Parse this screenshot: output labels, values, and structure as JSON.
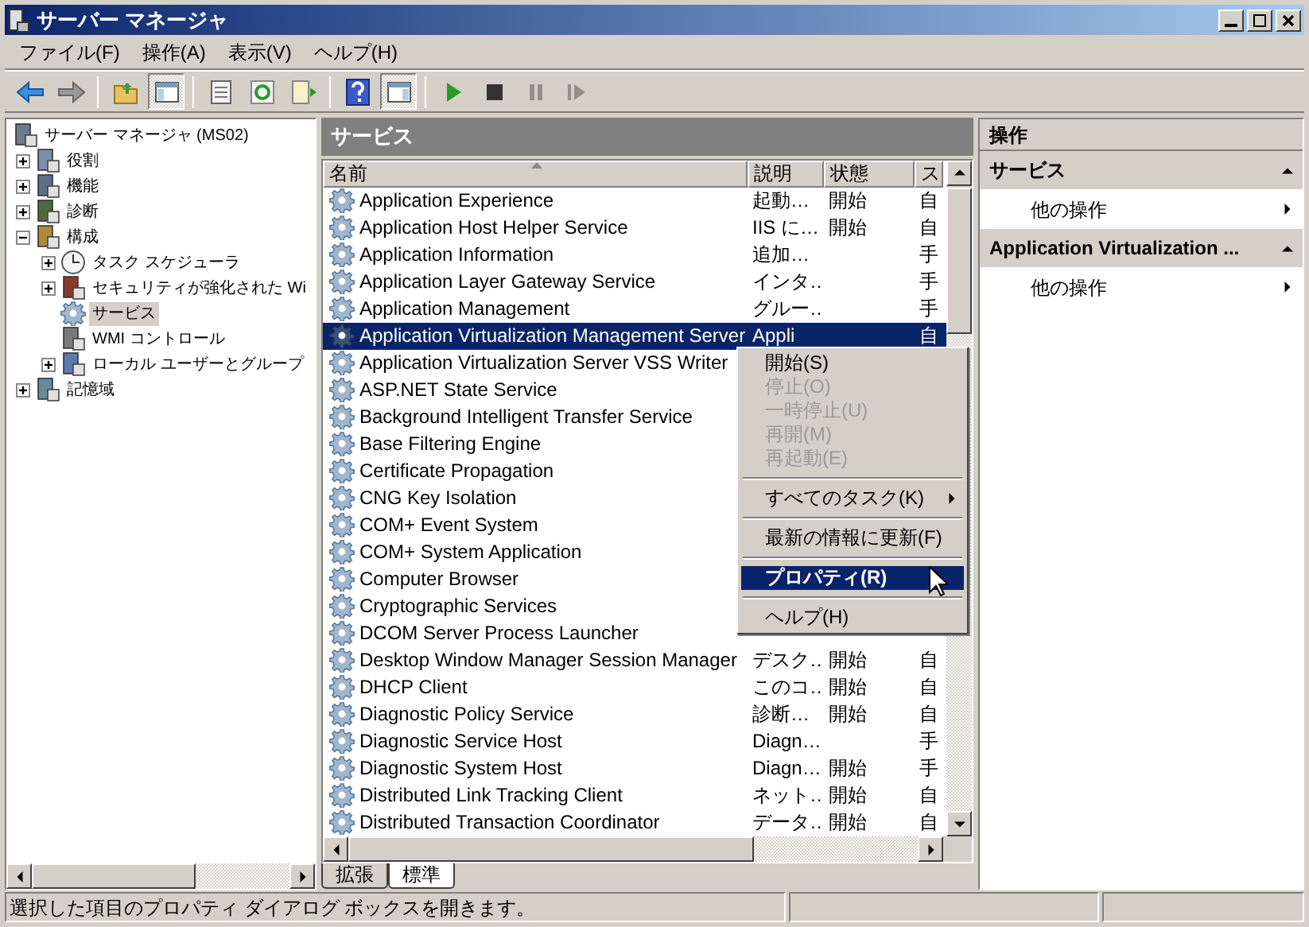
{
  "window": {
    "title": "サーバー マネージャ"
  },
  "menu": [
    "ファイル(F)",
    "操作(A)",
    "表示(V)",
    "ヘルプ(H)"
  ],
  "toolbar": [
    {
      "pressed": false,
      "disabled": false
    },
    {
      "pressed": false,
      "disabled": false
    },
    {
      "pressed": false,
      "disabled": false
    },
    {
      "pressed": true,
      "disabled": false
    },
    {
      "pressed": false,
      "disabled": false
    },
    {
      "pressed": false,
      "disabled": false
    },
    {
      "pressed": false,
      "disabled": false
    },
    {
      "pressed": false,
      "disabled": false
    },
    {
      "pressed": true,
      "disabled": false
    },
    {
      "pressed": false,
      "disabled": false
    },
    {
      "pressed": false,
      "disabled": false
    },
    {
      "pressed": false,
      "disabled": true
    },
    {
      "pressed": false,
      "disabled": true
    }
  ],
  "tree": [
    {
      "label": "サーバー マネージャ (MS02)",
      "has_toggle": false,
      "selected": false,
      "children": [
        {
          "label": "役割",
          "has_toggle": true,
          "expanded": false,
          "selected": false
        },
        {
          "label": "機能",
          "has_toggle": true,
          "expanded": false,
          "selected": false
        },
        {
          "label": "診断",
          "has_toggle": true,
          "expanded": false,
          "selected": false
        },
        {
          "label": "構成",
          "has_toggle": true,
          "expanded": true,
          "selected": false,
          "children": [
            {
              "label": "タスク スケジューラ",
              "has_toggle": true,
              "expanded": false,
              "selected": false
            },
            {
              "label": "セキュリティが強化された Wi",
              "has_toggle": true,
              "expanded": false,
              "selected": false
            },
            {
              "label": "サービス",
              "has_toggle": false,
              "expanded": false,
              "selected": true
            },
            {
              "label": "WMI コントロール",
              "has_toggle": false,
              "expanded": false,
              "selected": false
            },
            {
              "label": "ローカル ユーザーとグループ",
              "has_toggle": true,
              "expanded": false,
              "selected": false
            }
          ]
        },
        {
          "label": "記憶域",
          "has_toggle": true,
          "expanded": false,
          "selected": false
        }
      ]
    }
  ],
  "center": {
    "title": "サービス",
    "columns": [
      {
        "label": "名前",
        "sorted": true
      },
      {
        "label": "説明",
        "sorted": false
      },
      {
        "label": "状態",
        "sorted": false
      },
      {
        "label": "ス",
        "sorted": false
      }
    ],
    "rows": [
      {
        "name": "Application Experience",
        "description": "起動…",
        "status": "開始",
        "startup": "自",
        "selected": false
      },
      {
        "name": "Application Host Helper Service",
        "description": "IIS に…",
        "status": "開始",
        "startup": "自",
        "selected": false
      },
      {
        "name": "Application Information",
        "description": "追加…",
        "startup": "手",
        "selected": false
      },
      {
        "name": "Application Layer Gateway Service",
        "description": "インタ…",
        "startup": "手",
        "selected": false
      },
      {
        "name": "Application Management",
        "description": "グルー…",
        "startup": "手",
        "selected": false
      },
      {
        "name": "Application Virtualization Management Server",
        "description": "Appli",
        "startup": "自",
        "selected": true
      },
      {
        "name": "Application Virtualization Server VSS Writer",
        "selected": false
      },
      {
        "name": "ASP.NET State Service",
        "selected": false
      },
      {
        "name": "Background Intelligent Transfer Service",
        "selected": false
      },
      {
        "name": "Base Filtering Engine",
        "selected": false
      },
      {
        "name": "Certificate Propagation",
        "selected": false
      },
      {
        "name": "CNG Key Isolation",
        "selected": false
      },
      {
        "name": "COM+ Event System",
        "selected": false
      },
      {
        "name": "COM+ System Application",
        "selected": false
      },
      {
        "name": "Computer Browser",
        "selected": false
      },
      {
        "name": "Cryptographic Services",
        "selected": false
      },
      {
        "name": "DCOM Server Process Launcher",
        "selected": false
      },
      {
        "name": "Desktop Window Manager Session Manager",
        "description": "デスク…",
        "status": "開始",
        "startup": "自",
        "selected": false
      },
      {
        "name": "DHCP Client",
        "description": "このコ…",
        "status": "開始",
        "startup": "自",
        "selected": false
      },
      {
        "name": "Diagnostic Policy Service",
        "description": "診断…",
        "status": "開始",
        "startup": "自",
        "selected": false
      },
      {
        "name": "Diagnostic Service Host",
        "description": "Diagn…",
        "startup": "手",
        "selected": false
      },
      {
        "name": "Diagnostic System Host",
        "description": "Diagn…",
        "status": "開始",
        "startup": "手",
        "selected": false
      },
      {
        "name": "Distributed Link Tracking Client",
        "description": "ネット…",
        "status": "開始",
        "startup": "自",
        "selected": false
      },
      {
        "name": "Distributed Transaction Coordinator",
        "description": "データ…",
        "status": "開始",
        "startup": "自",
        "selected": false
      }
    ],
    "tabs": [
      {
        "label": "拡張",
        "selected": false
      },
      {
        "label": "標準",
        "selected": true
      }
    ]
  },
  "context_menu": [
    {
      "kind": "item",
      "label": "開始(S)",
      "disabled": false,
      "selected": false,
      "submenu": false
    },
    {
      "kind": "item",
      "label": "停止(O)",
      "disabled": true,
      "selected": false,
      "submenu": false
    },
    {
      "kind": "item",
      "label": "一時停止(U)",
      "disabled": true,
      "selected": false,
      "submenu": false
    },
    {
      "kind": "item",
      "label": "再開(M)",
      "disabled": true,
      "selected": false,
      "submenu": false
    },
    {
      "kind": "item",
      "label": "再起動(E)",
      "disabled": true,
      "selected": false,
      "submenu": false
    },
    {
      "kind": "separator"
    },
    {
      "kind": "item",
      "label": "すべてのタスク(K)",
      "disabled": false,
      "selected": false,
      "submenu": true
    },
    {
      "kind": "separator"
    },
    {
      "kind": "item",
      "label": "最新の情報に更新(F)",
      "disabled": false,
      "selected": false,
      "submenu": false
    },
    {
      "kind": "separator"
    },
    {
      "kind": "item",
      "label": "プロパティ(R)",
      "disabled": false,
      "selected": true,
      "submenu": false
    },
    {
      "kind": "separator"
    },
    {
      "kind": "item",
      "label": "ヘルプ(H)",
      "disabled": false,
      "selected": false,
      "submenu": false
    }
  ],
  "actions": {
    "title": "操作",
    "sections": [
      {
        "title": "サービス",
        "expanded": true,
        "items": [
          "他の操作"
        ]
      },
      {
        "title": "Application Virtualization ...",
        "expanded": true,
        "items": [
          "他の操作"
        ]
      }
    ]
  },
  "status_bar": {
    "text": "選択した項目のプロパティ ダイアログ ボックスを開きます。"
  }
}
